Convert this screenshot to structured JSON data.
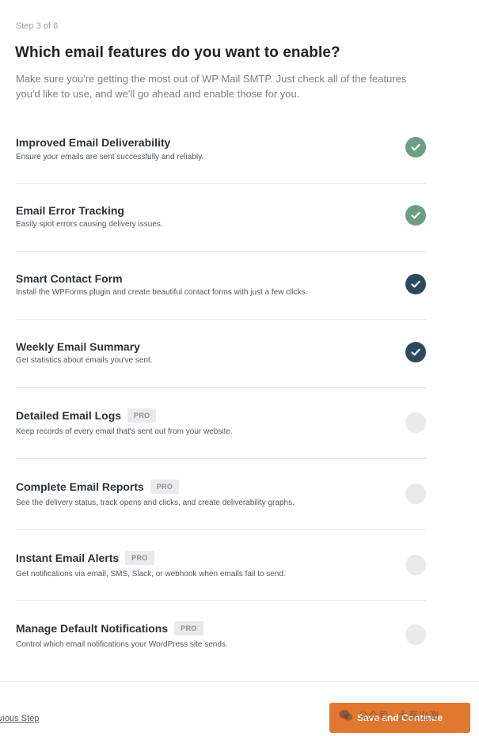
{
  "step_label": "Step 3 of 6",
  "title": "Which email features do you want to enable?",
  "intro": "Make sure you're getting the most out of WP Mail SMTP. Just check all of the features you'd like to use, and we'll go ahead and enable those for you.",
  "features": [
    {
      "name": "Improved Email Deliverability",
      "desc": "Ensure your emails are sent successfully and reliably.",
      "pro": "",
      "state": "checked-locked"
    },
    {
      "name": "Email Error Tracking",
      "desc": "Easily spot errors causing delivery issues.",
      "pro": "",
      "state": "checked-locked"
    },
    {
      "name": "Smart Contact Form",
      "desc": "Install the WPForms plugin and create beautiful contact forms with just a few clicks.",
      "pro": "",
      "state": "checked"
    },
    {
      "name": "Weekly Email Summary",
      "desc": "Get statistics about emails you've sent.",
      "pro": "",
      "state": "checked"
    },
    {
      "name": "Detailed Email Logs",
      "desc": "Keep records of every email that's sent out from your website.",
      "pro": "PRO",
      "state": "unchecked"
    },
    {
      "name": "Complete Email Reports",
      "desc": "See the delivery status, track opens and clicks, and create deliverability graphs.",
      "pro": "PRO",
      "state": "unchecked"
    },
    {
      "name": "Instant Email Alerts",
      "desc": "Get notifications via email, SMS, Slack, or webhook when emails fail to send.",
      "pro": "PRO",
      "state": "unchecked"
    },
    {
      "name": "Manage Default Notifications",
      "desc": "Control which email notifications your WordPress site sends.",
      "pro": "PRO",
      "state": "unchecked"
    }
  ],
  "footer": {
    "previous_label": "vious Step",
    "save_label": "Save and Continue",
    "watermark": "公众号 · 大享出海"
  },
  "colors": {
    "check_locked": "#6b9e86",
    "check_selected": "#2c4a5e",
    "check_empty": "#e9eaec",
    "accent_button": "#e27730"
  },
  "icons": {
    "check": "check-icon",
    "watermark": "wechat-icon"
  }
}
